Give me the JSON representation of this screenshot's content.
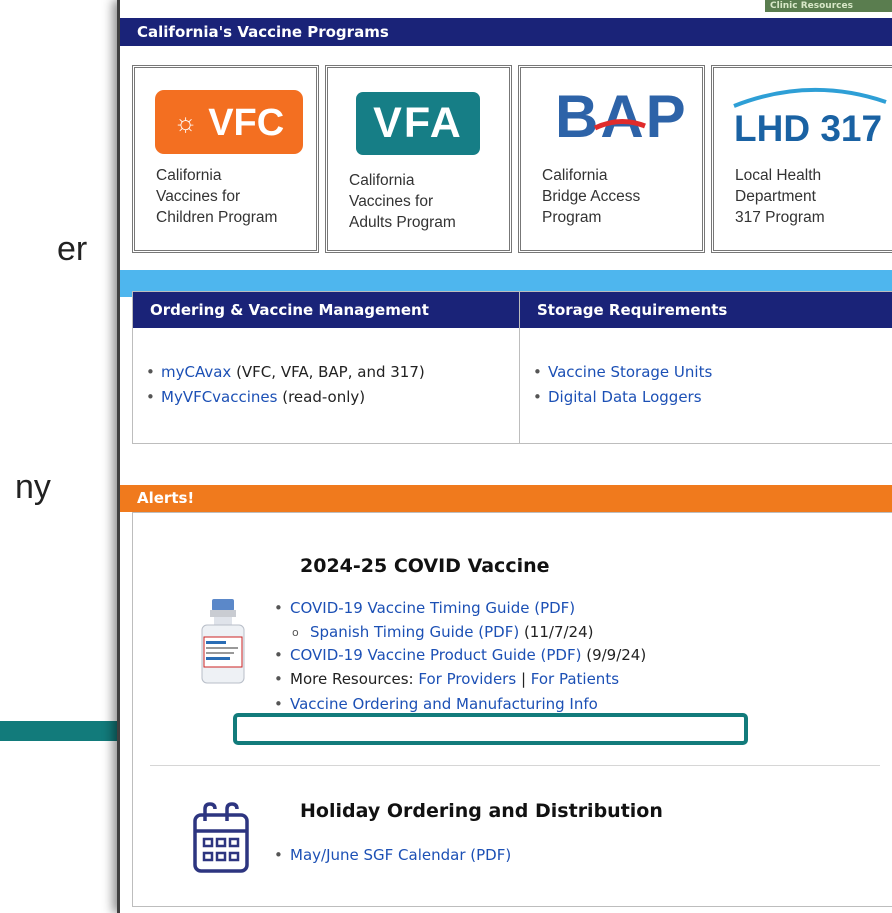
{
  "slide_fragments": [
    "er",
    "ny"
  ],
  "clinic_tab": "Clinic Resources",
  "programs_header": "California's Vaccine Programs",
  "programs": [
    {
      "logo": "VFC",
      "name": "California\nVaccines for\nChildren Program"
    },
    {
      "logo": "VFA",
      "name": "California\nVaccines for\nAdults Program"
    },
    {
      "logo": "BAP",
      "name": "California\nBridge Access\nProgram"
    },
    {
      "logo": "LHD 317",
      "name": "Local Health\nDepartment\n317 Program"
    }
  ],
  "ordering": {
    "header": "Ordering & Vaccine Management",
    "items": [
      {
        "link": "myCAvax",
        "rest": " (VFC, VFA, BAP, and 317)"
      },
      {
        "link": "MyVFCvaccines",
        "rest": " (read-only)"
      }
    ]
  },
  "storage": {
    "header": "Storage Requirements",
    "items": [
      {
        "link": "Vaccine Storage Units"
      },
      {
        "link": "Digital Data Loggers"
      }
    ]
  },
  "alerts": {
    "header": "Alerts!",
    "covid_title": "2024-25 COVID Vaccine",
    "covid_timing_link": "COVID-19 Vaccine Timing Guide (PDF)",
    "spanish_link": "Spanish Timing Guide (PDF)",
    "spanish_date": " (11/7/24)",
    "product_link": "COVID-19 Vaccine Product Guide (PDF)",
    "product_date": " (9/9/24)",
    "more_label": "More Resources: ",
    "providers_link": "For Providers",
    "sep": " | ",
    "patients_link": "For Patients",
    "ordering_link": "Vaccine Ordering and Manufacturing Info",
    "holiday_title": "Holiday Ordering and Distribution",
    "calendar_link": "May/June SGF Calendar (PDF)"
  },
  "colors": {
    "navy": "#1a2378",
    "sky": "#4eb6ee",
    "orange": "#f07a1d",
    "teal": "#127b7b",
    "link": "#1c50b5"
  }
}
